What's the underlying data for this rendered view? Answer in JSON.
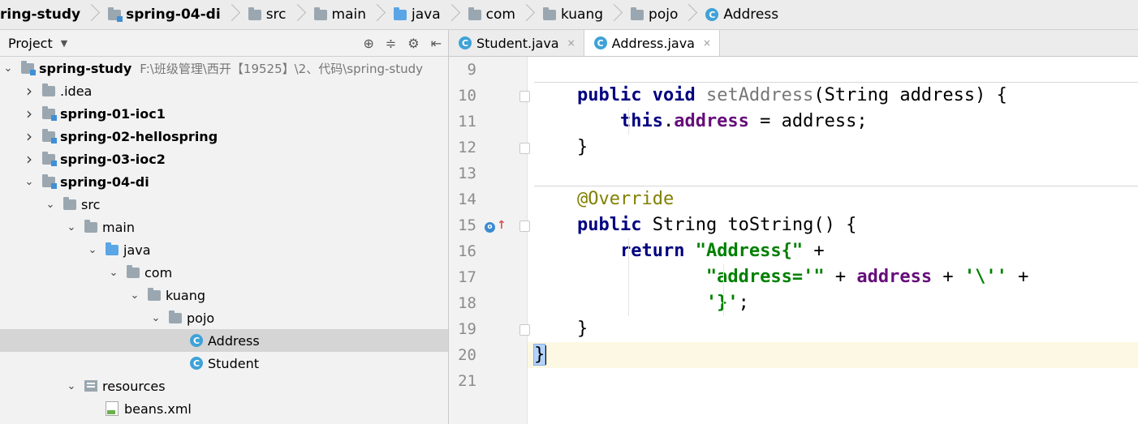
{
  "breadcrumb": [
    {
      "label": "ring-study",
      "icon": "none",
      "bold": true
    },
    {
      "label": "spring-04-di",
      "icon": "module-folder-icon",
      "bold": true
    },
    {
      "label": "src",
      "icon": "folder-icon",
      "bold": false
    },
    {
      "label": "main",
      "icon": "folder-icon",
      "bold": false
    },
    {
      "label": "java",
      "icon": "source-folder-icon",
      "bold": false
    },
    {
      "label": "com",
      "icon": "folder-icon",
      "bold": false
    },
    {
      "label": "kuang",
      "icon": "folder-icon",
      "bold": false
    },
    {
      "label": "pojo",
      "icon": "folder-icon",
      "bold": false
    },
    {
      "label": "Address",
      "icon": "class-icon",
      "bold": false
    }
  ],
  "project_panel": {
    "title": "Project",
    "tree": [
      {
        "label": "spring-study",
        "path": "F:\\班级管理\\西开【19525】\\2、代码\\spring-study",
        "arrow": "down",
        "icon": "module-folder-icon",
        "bold": true,
        "level": 0
      },
      {
        "label": ".idea",
        "arrow": "right",
        "icon": "folder-icon",
        "bold": false,
        "level": 1
      },
      {
        "label": "spring-01-ioc1",
        "arrow": "right",
        "icon": "module-folder-icon",
        "bold": true,
        "level": 1
      },
      {
        "label": "spring-02-hellospring",
        "arrow": "right",
        "icon": "module-folder-icon",
        "bold": true,
        "level": 1
      },
      {
        "label": "spring-03-ioc2",
        "arrow": "right",
        "icon": "module-folder-icon",
        "bold": true,
        "level": 1
      },
      {
        "label": "spring-04-di",
        "arrow": "down",
        "icon": "module-folder-icon",
        "bold": true,
        "level": 1
      },
      {
        "label": "src",
        "arrow": "down",
        "icon": "folder-icon",
        "bold": false,
        "level": 2
      },
      {
        "label": "main",
        "arrow": "down",
        "icon": "folder-icon",
        "bold": false,
        "level": 3
      },
      {
        "label": "java",
        "arrow": "down",
        "icon": "source-folder-icon",
        "bold": false,
        "level": 4
      },
      {
        "label": "com",
        "arrow": "down",
        "icon": "folder-icon",
        "bold": false,
        "level": 5
      },
      {
        "label": "kuang",
        "arrow": "down",
        "icon": "folder-icon",
        "bold": false,
        "level": 6
      },
      {
        "label": "pojo",
        "arrow": "down",
        "icon": "folder-icon",
        "bold": false,
        "level": 7
      },
      {
        "label": "Address",
        "arrow": "none",
        "icon": "class-icon",
        "bold": false,
        "level": 8,
        "selected": true
      },
      {
        "label": "Student",
        "arrow": "none",
        "icon": "class-icon",
        "bold": false,
        "level": 8
      },
      {
        "label": "resources",
        "arrow": "down",
        "icon": "resources-folder-icon",
        "bold": false,
        "level": 3
      },
      {
        "label": "beans.xml",
        "arrow": "none",
        "icon": "xml-file-icon",
        "bold": false,
        "level": 4
      }
    ]
  },
  "editor": {
    "tabs": [
      {
        "label": "Student.java",
        "active": false
      },
      {
        "label": "Address.java",
        "active": true
      }
    ],
    "line_numbers": [
      "9",
      "10",
      "11",
      "12",
      "13",
      "14",
      "15",
      "16",
      "17",
      "18",
      "19",
      "20",
      "21"
    ],
    "code_lines": [
      "",
      "    public void setAddress(String address) {",
      "        this.address = address;",
      "    }",
      "",
      "    @Override",
      "    public String toString() {",
      "        return \"Address{\" +",
      "                \"address='\" + address + '\\'' +",
      "                '}';",
      "    }",
      "}",
      ""
    ]
  },
  "colors": {
    "keyword": "#000080",
    "string": "#008000",
    "field": "#660e7a",
    "annotation": "#808000",
    "current_line": "#fcf8e3"
  }
}
